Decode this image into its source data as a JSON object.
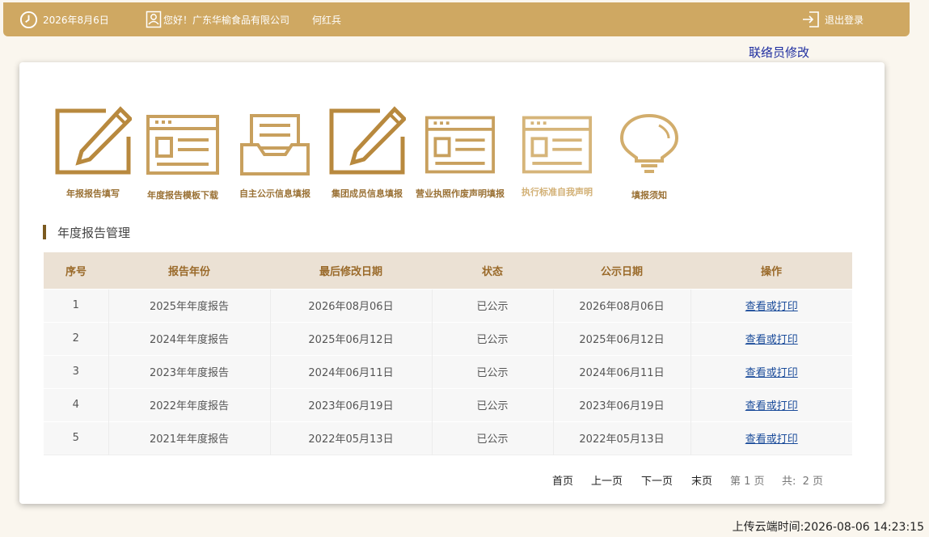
{
  "topbar": {
    "date": "2026年8月6日",
    "greeting": "您好！广东华榆食品有限公司",
    "user": "何红兵",
    "logout_label": "退出登录"
  },
  "contact_modify_label": "联络员修改",
  "icons": [
    {
      "label": "年报报告填写",
      "icon": "pencil-frame-icon"
    },
    {
      "label": "年度报告模板下载",
      "icon": "form-document-icon"
    },
    {
      "label": "自主公示信息填报",
      "icon": "inbox-tray-icon"
    },
    {
      "label": "集团成员信息填报",
      "icon": "pencil-frame-icon"
    },
    {
      "label": "营业执照作废声明填报",
      "icon": "form-document-icon"
    },
    {
      "label": "执行标准自我声明",
      "icon": "form-document-icon"
    },
    {
      "label": "填报须知",
      "icon": "lightbulb-icon"
    }
  ],
  "section_title": "年度报告管理",
  "table": {
    "headers": [
      "序号",
      "报告年份",
      "最后修改日期",
      "状态",
      "公示日期",
      "操作"
    ],
    "rows": [
      [
        "1",
        "2025年年度报告",
        "2026年08月06日",
        "已公示",
        "2026年08月06日",
        "查看或打印"
      ],
      [
        "2",
        "2024年年度报告",
        "2025年06月12日",
        "已公示",
        "2025年06月12日",
        "查看或打印"
      ],
      [
        "3",
        "2023年年度报告",
        "2024年06月11日",
        "已公示",
        "2024年06月11日",
        "查看或打印"
      ],
      [
        "4",
        "2022年年度报告",
        "2023年06月19日",
        "已公示",
        "2023年06月19日",
        "查看或打印"
      ],
      [
        "5",
        "2021年年度报告",
        "2022年05月13日",
        "已公示",
        "2022年05月13日",
        "查看或打印"
      ]
    ]
  },
  "pager": {
    "first": "首页",
    "prev": "上一页",
    "next": "下一页",
    "last": "末页",
    "current": "第 1 页",
    "total": "共:  2 页"
  },
  "upload_time": "上传云端时间:2026-08-06 14:23:15",
  "colors": {
    "gold": "#cfa862",
    "icon_gold": "#b8893e",
    "table_header_bg": "#ebe1d4",
    "link_blue": "#1a4b9a"
  }
}
